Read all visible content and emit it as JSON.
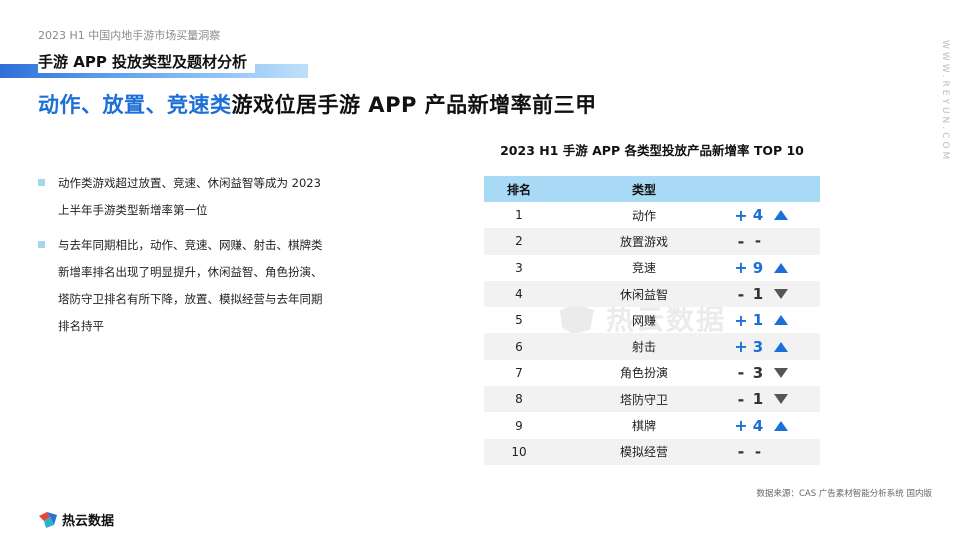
{
  "header": {
    "report_title": "2023 H1 中国内地手游市场买量洞察",
    "section_label": "手游 APP 投放类型及题材分析",
    "headline_highlight": "动作、放置、竞速类",
    "headline_rest": "游戏位居手游 APP 产品新增率前三甲",
    "side_brand": "WWW.REYUN.COM"
  },
  "bullets": [
    {
      "text": "动作类游戏超过放置、竞速、休闲益智等成为 2023 上半年手游类型新增率第一位"
    },
    {
      "text": "与去年同期相比，动作、竞速、网赚、射击、棋牌类新增率排名出现了明显提升，休闲益智、角色扮演、塔防守卫排名有所下降，放置、模拟经营与去年同期排名持平"
    }
  ],
  "table": {
    "title": "2023 H1 手游 APP 各类型投放产品新增率 TOP 10",
    "headers": {
      "rank": "排名",
      "type": "类型"
    },
    "rows": [
      {
        "rank": "1",
        "type": "动作",
        "sign": "+",
        "change": "4",
        "dir": "up"
      },
      {
        "rank": "2",
        "type": "放置游戏",
        "sign": "-",
        "change": "-",
        "dir": "flat"
      },
      {
        "rank": "3",
        "type": "竞速",
        "sign": "+",
        "change": "9",
        "dir": "up"
      },
      {
        "rank": "4",
        "type": "休闲益智",
        "sign": "-",
        "change": "1",
        "dir": "down"
      },
      {
        "rank": "5",
        "type": "网赚",
        "sign": "+",
        "change": "1",
        "dir": "up"
      },
      {
        "rank": "6",
        "type": "射击",
        "sign": "+",
        "change": "3",
        "dir": "up"
      },
      {
        "rank": "7",
        "type": "角色扮演",
        "sign": "-",
        "change": "3",
        "dir": "down"
      },
      {
        "rank": "8",
        "type": "塔防守卫",
        "sign": "-",
        "change": "1",
        "dir": "down"
      },
      {
        "rank": "9",
        "type": "棋牌",
        "sign": "+",
        "change": "4",
        "dir": "up"
      },
      {
        "rank": "10",
        "type": "模拟经营",
        "sign": "-",
        "change": "-",
        "dir": "flat"
      }
    ]
  },
  "watermark": {
    "text": "热云数据"
  },
  "source": "数据来源：CAS 广告素材智能分析系统 国内版",
  "footer": {
    "brand": "热云数据"
  },
  "colors": {
    "accent": "#1d6fd8",
    "header_bg": "#a9daf5",
    "row_alt": "#f2f2f2"
  }
}
